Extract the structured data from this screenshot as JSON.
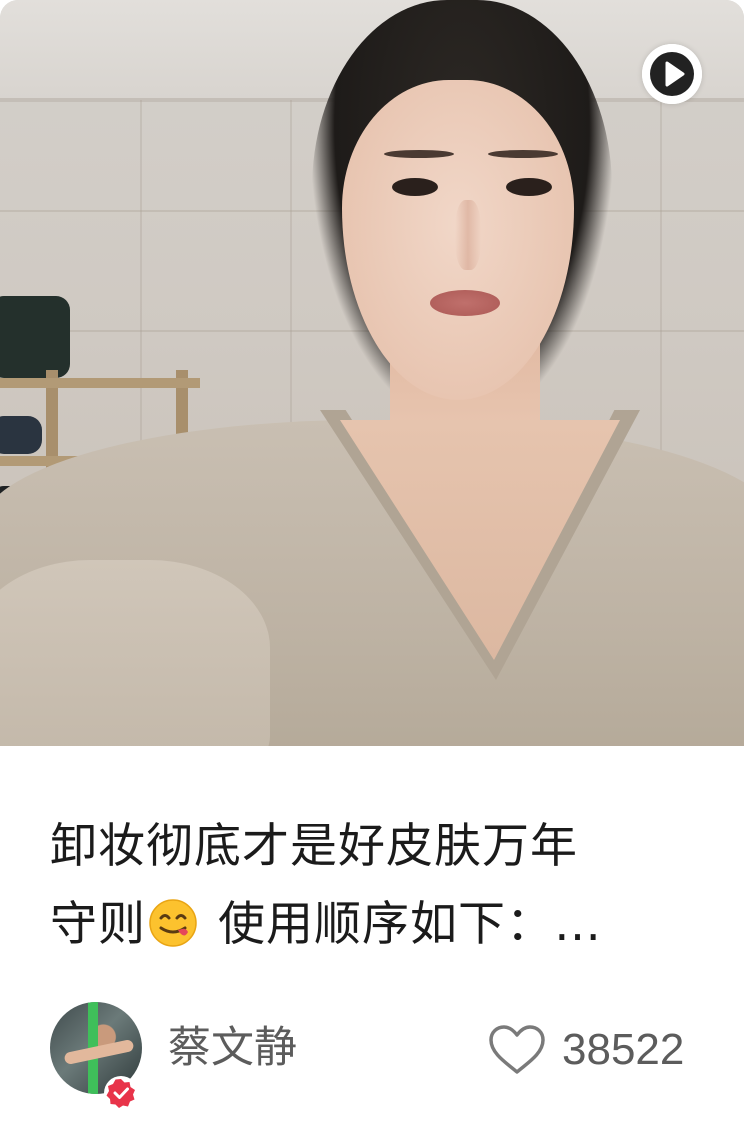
{
  "post": {
    "title_line1": "卸妆彻底才是好皮肤万年",
    "title_line2_start": "守则",
    "title_emoji": "yum-face-emoji",
    "title_line2_end": " 使用顺序如下：…"
  },
  "cover": {
    "media_type": "video",
    "play_icon": "play-icon"
  },
  "author": {
    "name": "蔡文静",
    "verified": true,
    "verified_icon": "verified-check-icon"
  },
  "likes": {
    "icon": "heart-outline-icon",
    "count": "38522"
  },
  "colors": {
    "text": "#1b1b1b",
    "meta_text": "#5c5c5c",
    "verified_red": "#e8344a",
    "play_icon": "#222222"
  }
}
